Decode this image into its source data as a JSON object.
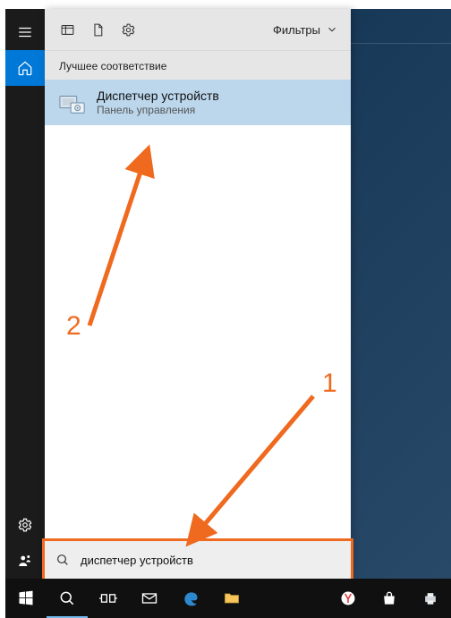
{
  "leftbar": {
    "menu": "menu",
    "home": "home",
    "settings": "settings",
    "share": "share"
  },
  "panel": {
    "filters_label": "Фильтры",
    "section_label": "Лучшее соответствие",
    "result": {
      "title": "Диспетчер устройств",
      "subtitle": "Панель управления"
    },
    "search_value": "диспетчер устройств"
  },
  "annotations": {
    "n1": "1",
    "n2": "2"
  },
  "taskbar": {
    "start": "start",
    "search": "search",
    "taskview": "taskview",
    "mail": "mail",
    "edge": "edge",
    "explorer": "explorer",
    "ybrowser": "ybrowser",
    "store": "store",
    "tray": "tray"
  }
}
